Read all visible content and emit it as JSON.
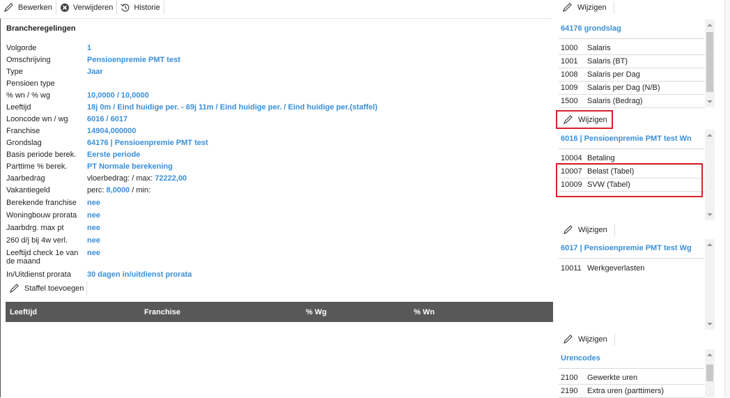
{
  "toolbar": {
    "edit_label": "Bewerken",
    "delete_label": "Verwijderen",
    "history_label": "Historie"
  },
  "left": {
    "section_title": "Brancheregelingen",
    "fields": [
      {
        "label": "Volgorde",
        "value": "1"
      },
      {
        "label": "Omschrijving",
        "value": "Pensioenpremie PMT test"
      },
      {
        "label": "Type",
        "value": "Jaar"
      },
      {
        "label": "Pensioen type",
        "value": ""
      },
      {
        "label": "% wn / % wg",
        "value": "10,0000 / 10,0000"
      },
      {
        "label": "Leeftijd",
        "value": "18j 0m / Eind huidige per. - 69j 11m / Eind huidige per. / Eind huidige per.(staffel)"
      },
      {
        "label": "Looncode wn / wg",
        "value": "6016 / 6017"
      },
      {
        "label": "Franchise",
        "value": "14904,000000"
      },
      {
        "label": "Grondslag",
        "value": "64176 | Pensioenpremie PMT test"
      },
      {
        "label": "Basis periode berek.",
        "value": "Eerste periode"
      },
      {
        "label": "Parttime % berek.",
        "value": "PT Normale berekening"
      }
    ],
    "jaarbedrag": {
      "label": "Jaarbedrag",
      "prefix": "vloerbedrag: / max:",
      "value": "72222,00"
    },
    "vakantiegeld": {
      "label": "Vakantiegeld",
      "prefix": "perc:",
      "value": "8,0000",
      "suffix": "/ min:"
    },
    "fields2": [
      {
        "label": "Berekende franchise",
        "value": "nee"
      },
      {
        "label": "Woningbouw prorata",
        "value": "nee"
      },
      {
        "label": "Jaarbdrg. max pt",
        "value": "nee"
      },
      {
        "label": "260 d/j bij 4w verl.",
        "value": "nee"
      }
    ],
    "leeftijd_check": {
      "label_line1": "Leeftijd check 1e van",
      "label_line2": "de maand",
      "value": "nee"
    },
    "inuit": {
      "label": "In/Uitdienst prorata",
      "value": "30 dagen in/uitdienst prorata"
    },
    "staffel_button": "Staffel toevoegen",
    "table_headers": [
      "Leeftijd",
      "Franchise",
      "% Wg",
      "% Wn"
    ]
  },
  "right": {
    "change_label": "Wijzigen",
    "grondslag": {
      "title": "64176 grondslag",
      "items": [
        {
          "code": "1000",
          "name": "Salaris"
        },
        {
          "code": "1001",
          "name": "Salaris (BT)"
        },
        {
          "code": "1008",
          "name": "Salaris per Dag"
        },
        {
          "code": "1009",
          "name": "Salaris per Dag (N/B)"
        },
        {
          "code": "1500",
          "name": "Salaris (Bedrag)"
        }
      ]
    },
    "wn": {
      "title": "6016 | Pensioenpremie PMT test Wn",
      "items": [
        {
          "code": "10004",
          "name": "Betaling"
        },
        {
          "code": "10007",
          "name": "Belast (Tabel)"
        },
        {
          "code": "10009",
          "name": "SVW (Tabel)"
        }
      ]
    },
    "wg": {
      "title": "6017 | Pensioenpremie PMT test Wg",
      "items": [
        {
          "code": "10011",
          "name": "Werkgeverlasten"
        }
      ]
    },
    "urencodes": {
      "title": "Urencodes",
      "items": [
        {
          "code": "2100",
          "name": "Gewerkte uren"
        },
        {
          "code": "2190",
          "name": "Extra uren (parttimers)"
        }
      ]
    }
  },
  "colors": {
    "accent": "#3a8fd8",
    "table_header": "#585858",
    "highlight": "#d9202a"
  }
}
